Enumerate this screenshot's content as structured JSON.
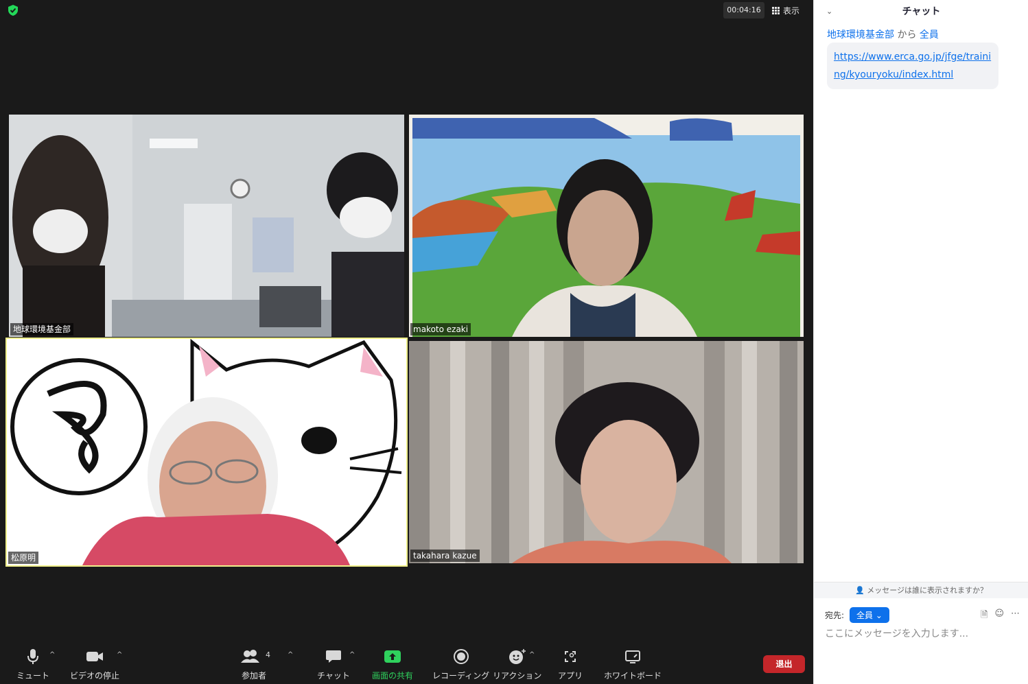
{
  "meeting": {
    "timer": "00:04:16",
    "view_label": "表示",
    "participants": [
      {
        "name": "地球環境基金部"
      },
      {
        "name": "makoto ezaki"
      },
      {
        "name": "松原明"
      },
      {
        "name": "takahara kazue"
      }
    ]
  },
  "toolbar": {
    "mute": "ミュート",
    "stop_video": "ビデオの停止",
    "participants": "参加者",
    "participants_count": "4",
    "chat": "チャット",
    "share": "画面の共有",
    "record": "レコーディング",
    "reactions": "リアクション",
    "apps": "アプリ",
    "whiteboard": "ホワイトボード",
    "leave": "退出"
  },
  "chat": {
    "title": "チャット",
    "message": {
      "sender": "地球環境基金部",
      "from_word": "から",
      "recipient": "全員",
      "text": "https://www.erca.go.jp/jfge/training/kyouryoku/index.html"
    },
    "who_sees": "メッセージは誰に表示されますか？",
    "to_label": "宛先:",
    "to_value": "全員",
    "input_placeholder": "ここにメッセージを入力します..."
  },
  "colors": {
    "accent_blue": "#0e71eb",
    "share_green": "#2fd15d",
    "leave_red": "#c4262a",
    "active_speaker": "#f0f08a"
  }
}
